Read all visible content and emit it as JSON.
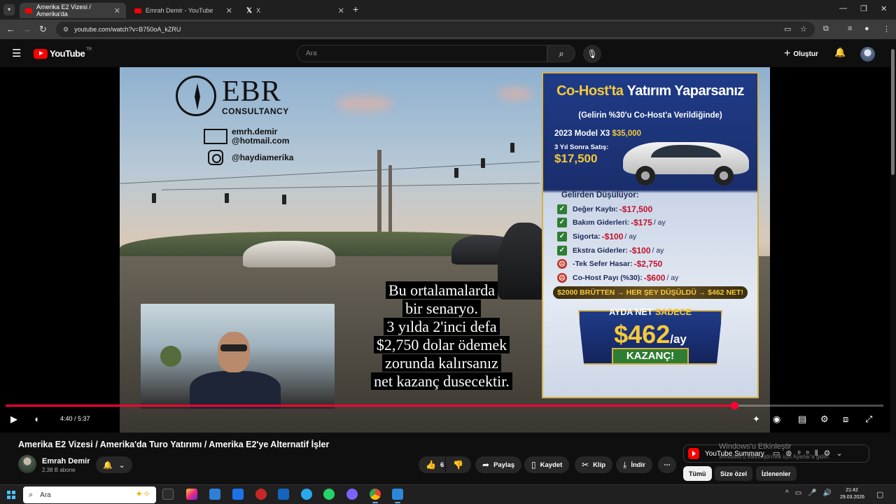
{
  "browser": {
    "tabs": [
      {
        "title": "Amerika E2 Vizesi / Amerika'da",
        "active": true,
        "icon": "youtube-icon"
      },
      {
        "title": "Emrah Demir - YouTube",
        "active": false,
        "icon": "youtube-icon"
      },
      {
        "title": "X",
        "active": false,
        "icon": "x-icon"
      }
    ],
    "url": "youtube.com/watch?v=B750oA_kZRU"
  },
  "youtube": {
    "logo_text": "YouTube",
    "region": "TR",
    "search_placeholder": "Ara",
    "create_label": "Oluştur"
  },
  "video_frame": {
    "brand": "EBR",
    "brand_sub": "CONSULTANCY",
    "email_line1": "emrh.demir",
    "email_line2": "@hotmail.com",
    "instagram": "@haydiamerika",
    "caption_lines": [
      "Bu ortalamalarda",
      "bir senaryo.",
      "3 yılda 2'inci defa",
      "$2,750 dolar ödemek",
      "zorunda kalırsanız",
      "net kazanç dusecektir."
    ],
    "poster": {
      "title_a": "Co-Host'ta",
      "title_b": "Yatırım Yaparsanız",
      "subtitle": "(Gelirin %30'u Co-Host'a Verildiğinde)",
      "model_label": "2023 Model X3",
      "model_price": "$35,000",
      "resale_label": "3 Yıl Sonra Satış:",
      "resale_price": "$17,500",
      "deductions_title": "Gelirden Düşülüyor:",
      "deductions": [
        {
          "icon": "check-icon",
          "label": "Değer Kaybı:",
          "amount": "-$17,500",
          "per": ""
        },
        {
          "icon": "check-icon",
          "label": "Bakım Giderleri:",
          "amount": "-$175",
          "per": "/ ay"
        },
        {
          "icon": "check-icon",
          "label": "Sigorta:",
          "amount": "-$100",
          "per": "/ ay"
        },
        {
          "icon": "check-icon",
          "label": "Ekstra Giderler:",
          "amount": "-$100",
          "per": "/ ay"
        },
        {
          "icon": "sad-face-icon",
          "label": "-Tek Sefer Hasar:",
          "amount": "-$2,750",
          "per": ""
        },
        {
          "icon": "sad-face-icon",
          "label": "Co-Host Payı (%30):",
          "amount": "-$600",
          "per": "/ ay"
        }
      ],
      "summary_bar": "$2000 BRÜTTEN → HER ŞEY DÜŞÜLDÜ → $462 NET!",
      "badge_top_a": "AYDA NET",
      "badge_top_b": "SADECE",
      "badge_amount": "$462",
      "badge_unit": "/ay",
      "badge_bottom": "KAZANÇ!"
    }
  },
  "player": {
    "current_time": "4:40",
    "duration": "5:37",
    "time_label": "4:40 / 5:37",
    "progress_fraction": 0.83,
    "accent": "#ff0033"
  },
  "video": {
    "title": "Amerika E2 Vizesi / Amerika'da Turo Yatırımı / Amerika E2'ye Alternatif İşler",
    "channel": "Emrah Demir",
    "subscribers": "2,38 B abone",
    "likes": "6",
    "share_label": "Paylaş",
    "save_label": "Kaydet",
    "clip_label": "Klip",
    "download_label": "İndir"
  },
  "sidepanel": {
    "summary_label": "YouTube Summary",
    "chips": [
      "Tümü",
      "Size özel",
      "İzlenenler"
    ]
  },
  "windows": {
    "activation_title": "Windows'u Etkinleştir",
    "activation_sub": "Windows'u etkinleştirmek için Ayarlar'a gidin.",
    "search_placeholder": "Ara",
    "time": "21:42",
    "date": "29.03.2026"
  }
}
